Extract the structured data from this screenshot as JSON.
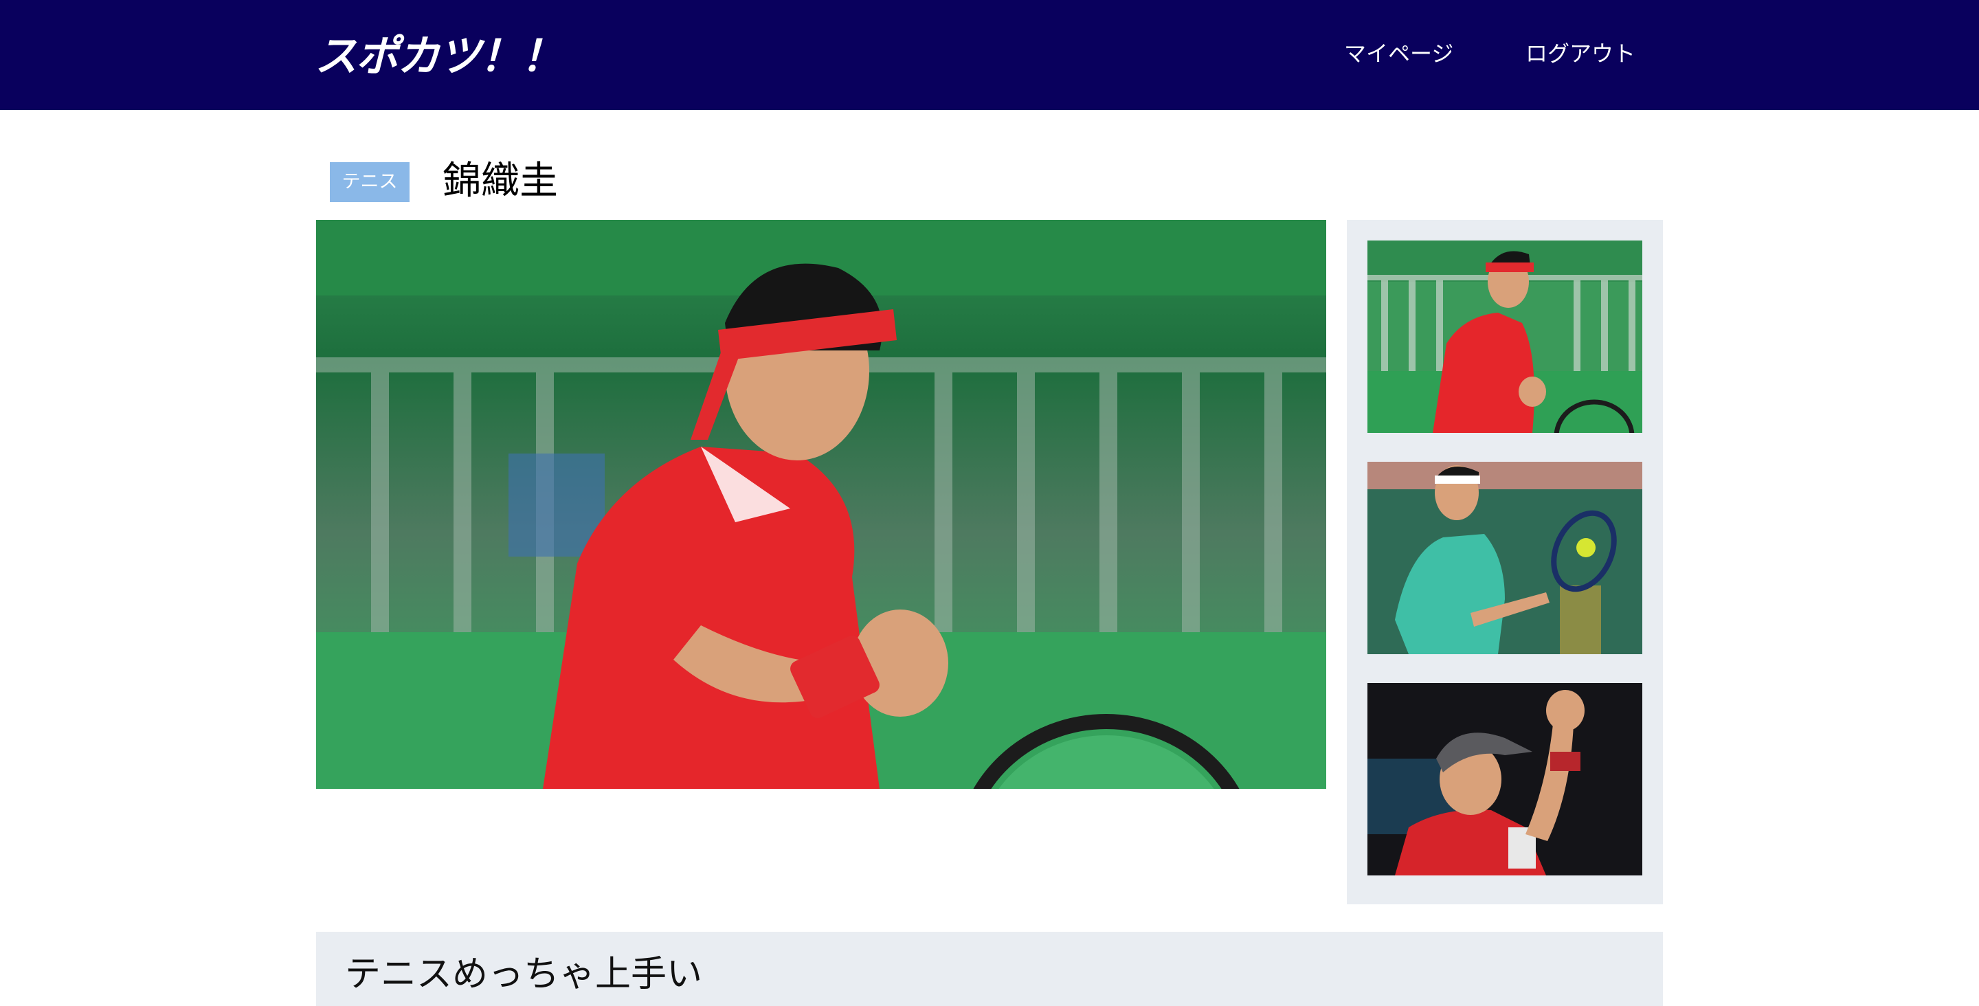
{
  "header": {
    "logo": "スポカツ！！",
    "nav": {
      "mypage": "マイページ",
      "logout": "ログアウト"
    },
    "bg_color": "#09005d"
  },
  "athlete": {
    "sport_tag": "テニス",
    "name": "錦織圭",
    "tag_color": "#8ab8e8"
  },
  "gallery": {
    "main_photo": "tennis-player-fist-pump-photo",
    "thumbnails": [
      "tennis-player-red-shirt-photo",
      "tennis-player-backhand-photo",
      "tennis-player-cap-fist-photo"
    ]
  },
  "comment": {
    "text": "テニスめっちゃ上手い"
  }
}
